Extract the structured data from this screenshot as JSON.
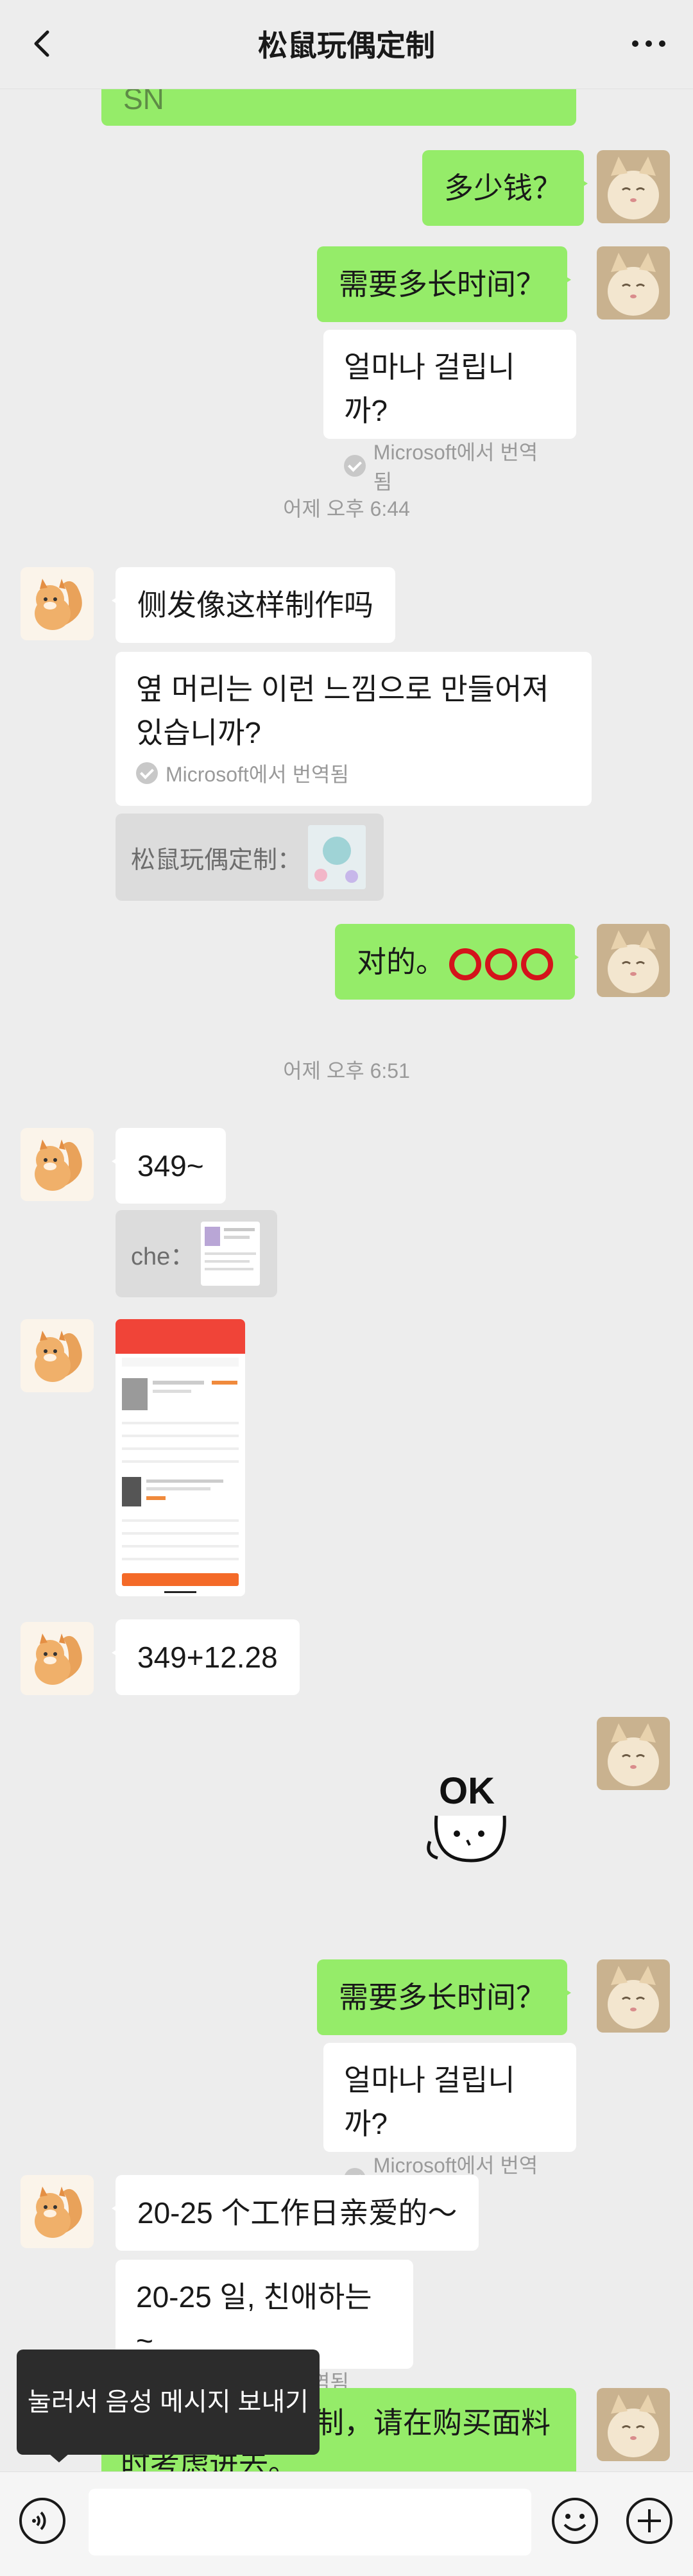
{
  "header": {
    "title": "松鼠玩偶定制"
  },
  "messages": {
    "top_partial": "SN",
    "m1": "多少钱？",
    "m2": "需要多长时间？",
    "m2_trans": "얼마나 걸립니까?",
    "translated_by": "Microsoft에서 번역됨",
    "time1": "어제 오후 6:44",
    "m3": "侧发像这样制作吗",
    "m3_trans_line1": "옆 머리는 이런 느낌으로 만들어져",
    "m3_trans_line2": "있습니까?",
    "quote1": "松鼠玩偶定制：",
    "m4": "对的。",
    "time2": "어제 오후 6:51",
    "m5": "349~",
    "quote2": "che：",
    "m6": "349+12.28",
    "m7": "需要多长时间？",
    "m7_trans": "얼마나 걸립니까?",
    "m8": "20-25 个工作日亲爱的～",
    "m8_trans": "20-25 일, 친애하는 ~",
    "m9_partial_line1": "制，请在购买面料",
    "m9_partial_line2": "时考虑进去。"
  },
  "sticker": {
    "text": "OK"
  },
  "tooltip": {
    "text": "눌러서 음성 메시지 보내기"
  },
  "colors": {
    "green_bubble": "#95ec69",
    "background": "#ededed",
    "red_circle": "#d4131b"
  }
}
